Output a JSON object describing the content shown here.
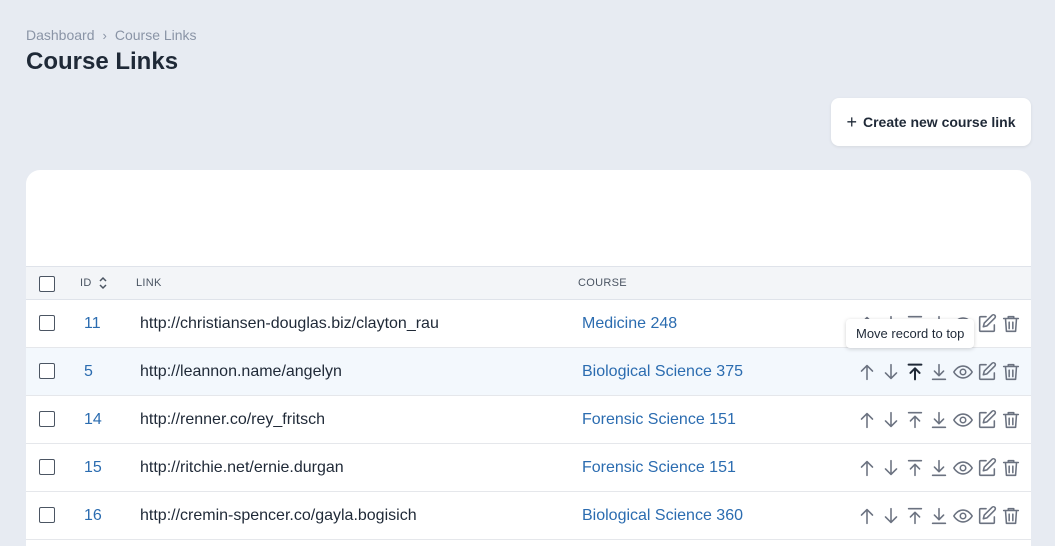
{
  "breadcrumb": {
    "items": [
      "Dashboard",
      "Course Links"
    ],
    "separator": "›"
  },
  "page": {
    "title": "Course Links"
  },
  "toolbar": {
    "create_label": "Create new course link",
    "create_icon": "plus-icon"
  },
  "table": {
    "headers": {
      "id": "ID",
      "link": "LINK",
      "course": "COURSE"
    },
    "rows": [
      {
        "id": "11",
        "link": "http://christiansen-douglas.biz/clayton_rau",
        "course": "Medicine 248"
      },
      {
        "id": "5",
        "link": "http://leannon.name/angelyn",
        "course": "Biological Science 375"
      },
      {
        "id": "14",
        "link": "http://renner.co/rey_fritsch",
        "course": "Forensic Science 151"
      },
      {
        "id": "15",
        "link": "http://ritchie.net/ernie.durgan",
        "course": "Forensic Science 151"
      },
      {
        "id": "16",
        "link": "http://cremin-spencer.co/gayla.bogisich",
        "course": "Biological Science 360"
      }
    ],
    "row_actions": [
      "arrow-up-icon",
      "arrow-down-icon",
      "move-to-top-icon",
      "move-to-bottom-icon",
      "eye-icon",
      "edit-icon",
      "trash-icon"
    ]
  },
  "tooltip": {
    "text": "Move record to top"
  },
  "colors": {
    "background": "#e7ebf2",
    "link": "#2b6cb0",
    "icon": "#6b7280",
    "icon_active": "#1f2937",
    "row_hover": "#f3f8fd"
  }
}
